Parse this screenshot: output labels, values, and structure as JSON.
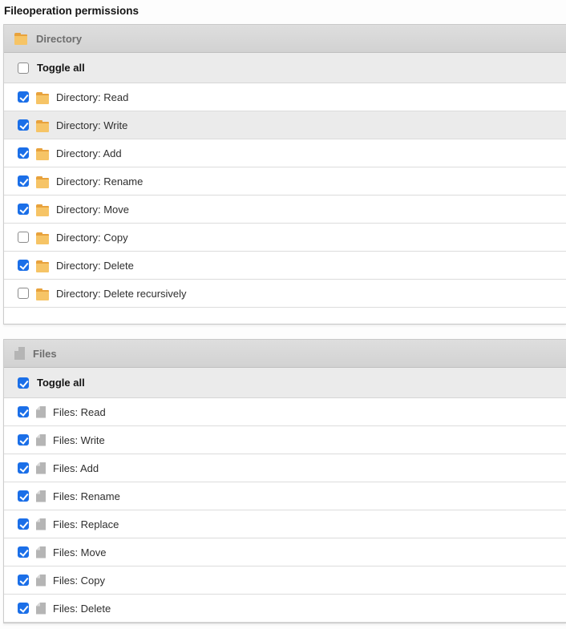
{
  "page": {
    "title": "Fileoperation permissions"
  },
  "colors": {
    "checkbox_checked": "#1b6fe8",
    "folder_icon": "#f6c466",
    "folder_icon_tab": "#e8a23c",
    "file_icon": "#b5b5b5",
    "header_text": "#6e6e6e",
    "header_bg": "#d8d8d8",
    "row_highlight": "#ebebeb"
  },
  "sections": [
    {
      "label": "Directory",
      "icon": "folder-icon",
      "toggle_all": {
        "label": "Toggle all",
        "checked": false
      },
      "items": [
        {
          "label": "Directory: Read",
          "checked": true,
          "highlighted": false
        },
        {
          "label": "Directory: Write",
          "checked": true,
          "highlighted": true
        },
        {
          "label": "Directory: Add",
          "checked": true,
          "highlighted": false
        },
        {
          "label": "Directory: Rename",
          "checked": true,
          "highlighted": false
        },
        {
          "label": "Directory: Move",
          "checked": true,
          "highlighted": false
        },
        {
          "label": "Directory: Copy",
          "checked": false,
          "highlighted": false
        },
        {
          "label": "Directory: Delete",
          "checked": true,
          "highlighted": false
        },
        {
          "label": "Directory: Delete recursively",
          "checked": false,
          "highlighted": false
        }
      ]
    },
    {
      "label": "Files",
      "icon": "file-icon",
      "toggle_all": {
        "label": "Toggle all",
        "checked": true
      },
      "items": [
        {
          "label": "Files: Read",
          "checked": true,
          "highlighted": false
        },
        {
          "label": "Files: Write",
          "checked": true,
          "highlighted": false
        },
        {
          "label": "Files: Add",
          "checked": true,
          "highlighted": false
        },
        {
          "label": "Files: Rename",
          "checked": true,
          "highlighted": false
        },
        {
          "label": "Files: Replace",
          "checked": true,
          "highlighted": false
        },
        {
          "label": "Files: Move",
          "checked": true,
          "highlighted": false
        },
        {
          "label": "Files: Copy",
          "checked": true,
          "highlighted": false
        },
        {
          "label": "Files: Delete",
          "checked": true,
          "highlighted": false
        }
      ]
    }
  ]
}
